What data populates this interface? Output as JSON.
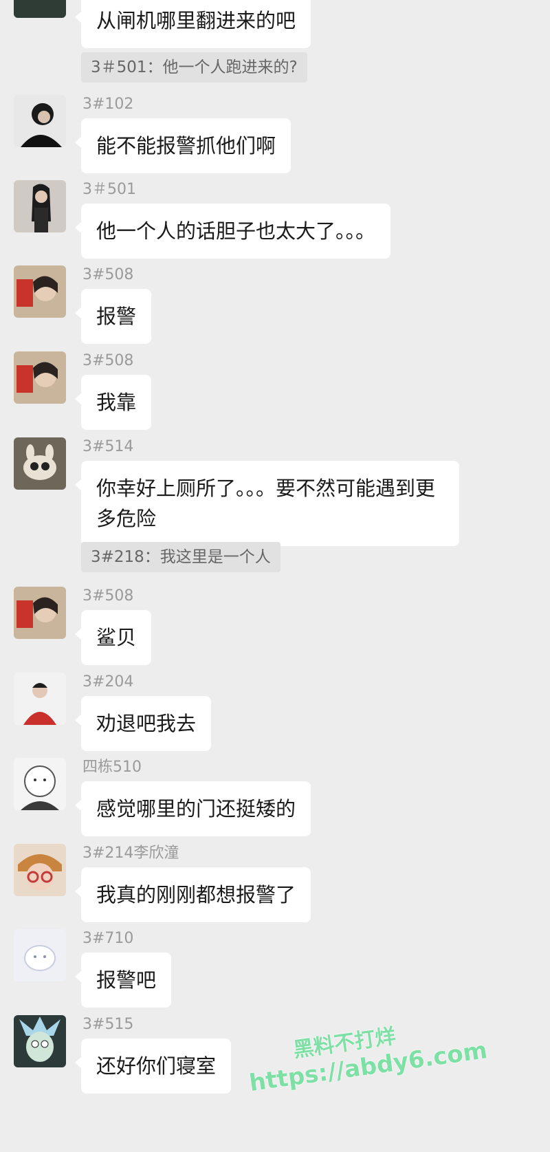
{
  "messages": [
    {
      "sender": "",
      "text": "从闸机哪里翻进来的吧",
      "quote": "3＃501：他一个人跑进来的?"
    },
    {
      "sender": "3#102",
      "text": "能不能报警抓他们啊"
    },
    {
      "sender": "3＃501",
      "text": "他一个人的话胆子也太大了。。。"
    },
    {
      "sender": "3#508",
      "text": "报警"
    },
    {
      "sender": "3#508",
      "text": "我靠"
    },
    {
      "sender": "3#514",
      "text": "你幸好上厕所了。。。要不然可能遇到更多危险",
      "quote": "3#218：我这里是一个人"
    },
    {
      "sender": "3#508",
      "text": "鲨贝"
    },
    {
      "sender": "3#204",
      "text": "劝退吧我去"
    },
    {
      "sender": "四栋510",
      "text": "感觉哪里的门还挺矮的"
    },
    {
      "sender": "3#214李欣潼",
      "text": "我真的刚刚都想报警了"
    },
    {
      "sender": "3#710",
      "text": "报警吧"
    },
    {
      "sender": "3#515",
      "text": "还好你们寝室"
    }
  ],
  "watermark": {
    "title": "黑料不打烊",
    "url": "https://abdy6.com"
  },
  "colors": {
    "background": "#ededed",
    "bubble": "#ffffff",
    "quote_bg": "#e1e1e1",
    "watermark": "#7fe0a6"
  }
}
